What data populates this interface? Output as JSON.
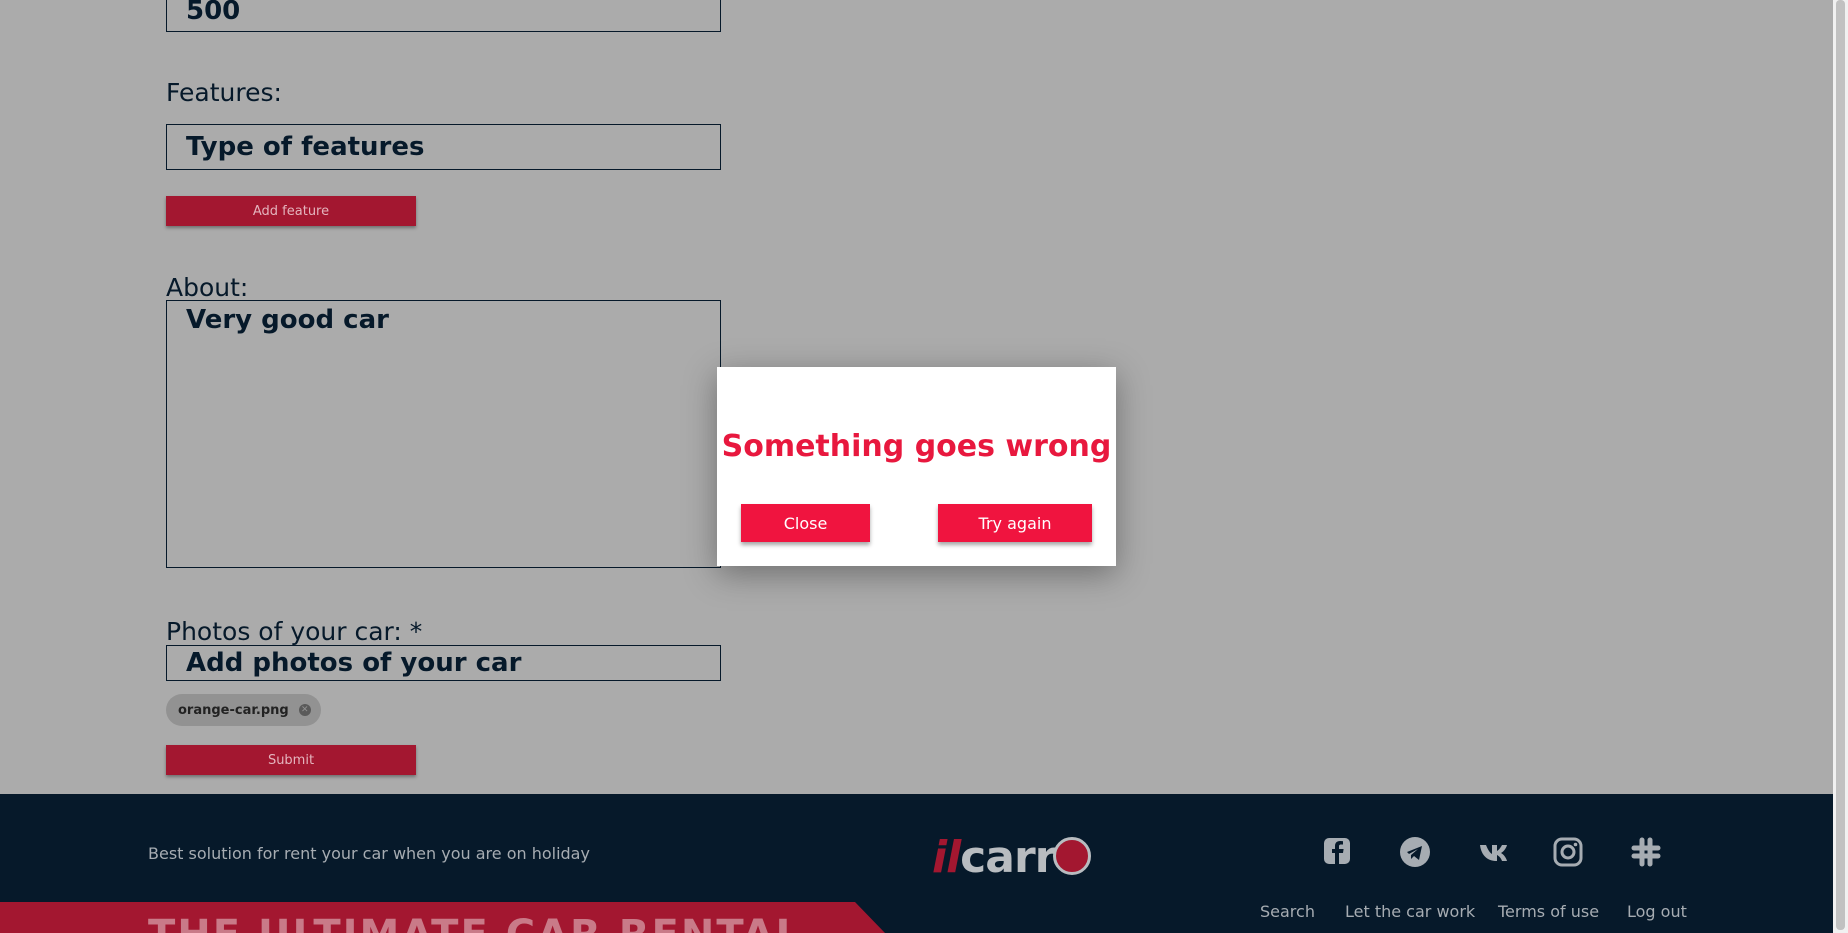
{
  "form": {
    "price_value": "500",
    "features_label": "Features:",
    "features_placeholder": "Type of features",
    "add_feature_label": "Add feature",
    "about_label": "About:",
    "about_value": "Very good car",
    "photos_label": "Photos of your car: *",
    "photos_placeholder": "Add photos of your car",
    "photo_chip": "orange-car.png",
    "submit_label": "Submit"
  },
  "modal": {
    "title": "Something goes wrong",
    "close_label": "Close",
    "try_again_label": "Try again"
  },
  "footer": {
    "tagline": "Best solution for rent your car when you are on holiday",
    "logo_il": "il",
    "logo_carr": "carr",
    "social_icons": [
      "facebook-icon",
      "telegram-icon",
      "vk-icon",
      "instagram-icon",
      "slack-icon"
    ],
    "links": [
      "Search",
      "Let the car work",
      "Terms of use",
      "Log out"
    ],
    "banner_text": "THE ULTIMATE CAR RENTAL"
  },
  "colors": {
    "overlay_bg": "#ababab",
    "accent": "#f0143f",
    "brand_dark": "#06192a",
    "brand_red": "#a31730"
  }
}
